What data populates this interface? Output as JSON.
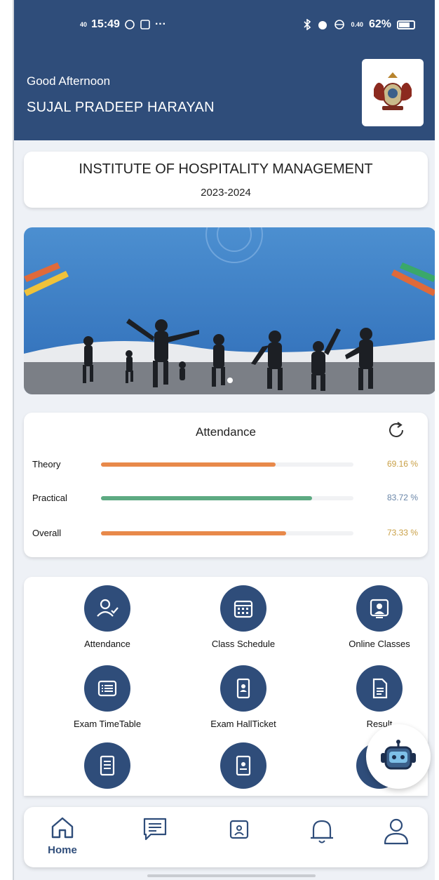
{
  "status_bar": {
    "time": "15:49",
    "signal_small": "40",
    "network_rate": "0.40",
    "battery": "62%"
  },
  "header": {
    "greeting": "Good Afternoon",
    "username": "SUJAL PRADEEP HARAYAN"
  },
  "institute": {
    "name": "INSTITUTE OF HOSPITALITY MANAGEMENT",
    "year": "2023-2024"
  },
  "attendance": {
    "title": "Attendance",
    "rows": [
      {
        "label": "Theory",
        "value": "69.16 %",
        "fraction": 0.6916,
        "color": "#e8894a",
        "value_color": "#c9a046"
      },
      {
        "label": "Practical",
        "value": "83.72 %",
        "fraction": 0.8372,
        "color": "#5daa82",
        "value_color": "#6a86a8"
      },
      {
        "label": "Overall",
        "value": "73.33 %",
        "fraction": 0.7333,
        "color": "#e8894a",
        "value_color": "#c9a046"
      }
    ]
  },
  "menu": [
    {
      "label": "Attendance",
      "icon": "user-check-icon"
    },
    {
      "label": "Class Schedule",
      "icon": "calendar-icon"
    },
    {
      "label": "Online Classes",
      "icon": "video-class-icon"
    },
    {
      "label": "Exam TimeTable",
      "icon": "list-icon"
    },
    {
      "label": "Exam HallTicket",
      "icon": "id-badge-icon"
    },
    {
      "label": "Result",
      "icon": "document-icon"
    },
    {
      "label": "",
      "icon": "notes-icon"
    },
    {
      "label": "",
      "icon": "id-card-icon"
    },
    {
      "label": "",
      "icon": "clock-icon"
    }
  ],
  "bottom_nav": {
    "home_label": "Home"
  },
  "colors": {
    "primary": "#2f4d7a",
    "background": "#eef1f6",
    "theory": "#e8894a",
    "practical": "#5daa82"
  }
}
